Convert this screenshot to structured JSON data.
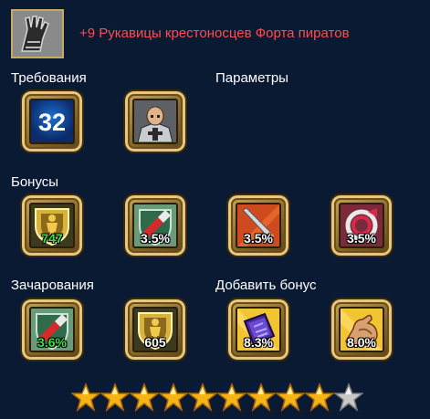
{
  "item": {
    "name": "+9 Рукавицы крестоносцев Форта пиратов",
    "icon": "gauntlet-icon",
    "name_color": "#ff4d4d"
  },
  "sections": {
    "requirements": "Требования",
    "parameters": "Параметры",
    "bonuses": "Бонусы",
    "enchantments": "Зачарования",
    "add_bonus": "Добавить бонус"
  },
  "requirements": {
    "level": "32",
    "character_icon": "knight-portrait-icon"
  },
  "bonuses": [
    {
      "icon": "health-shield-icon",
      "value": "747",
      "color": "green"
    },
    {
      "icon": "critical-shield-icon",
      "value": "3.5%",
      "color": "white"
    },
    {
      "icon": "sword-attack-icon",
      "value": "3.5%",
      "color": "white"
    },
    {
      "icon": "critical-ring-icon",
      "value": "3.5%",
      "color": "white"
    }
  ],
  "enchantments": [
    {
      "icon": "critical-shield-icon",
      "value": "3.6%",
      "color": "green"
    },
    {
      "icon": "health-shield-icon",
      "value": "605",
      "color": "white"
    }
  ],
  "add_bonus": [
    {
      "icon": "magic-tome-icon",
      "value": "8.3%",
      "color": "white"
    },
    {
      "icon": "strength-arm-icon",
      "value": "8.0%",
      "color": "white"
    }
  ],
  "stars": {
    "filled": 9,
    "total": 10
  }
}
